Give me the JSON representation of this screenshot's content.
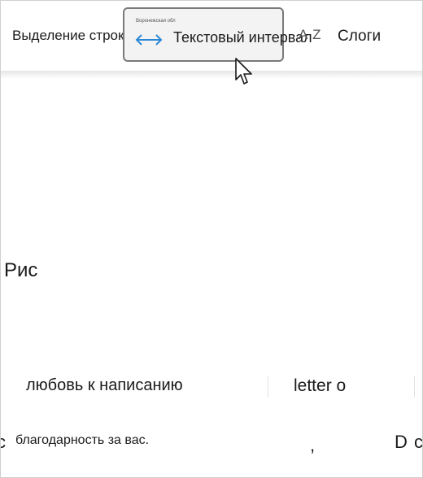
{
  "toolbar": {
    "line_focus_label": "Выделение строк",
    "text_spacing": {
      "preview_text": "Воронежская обл",
      "label": "Текстовый интервал"
    },
    "az_icon_text": "A Z",
    "syllables_label": "Слоги"
  },
  "document": {
    "pic_word": "Рис",
    "love_writing": "любовь к написанию",
    "letter_o": "letter o",
    "thanks": "благодарность за вас.",
    "frag_c": "c",
    "frag_comma": ",",
    "frag_d": "D",
    "frag_c2": "c"
  },
  "colors": {
    "accent_arrow": "#2b88d8",
    "button_border": "#7a7a7a",
    "button_bg": "#f3f3f3"
  }
}
